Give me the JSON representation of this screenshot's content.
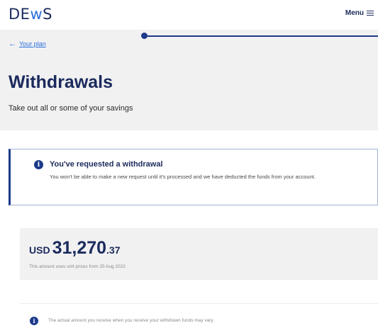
{
  "header": {
    "logo_prefix": "DE",
    "logo_accent": "w",
    "logo_suffix": "S",
    "menu_label": "Menu"
  },
  "nav": {
    "back_label": "Your plan"
  },
  "page": {
    "title": "Withdrawals",
    "subtitle": "Take out all or some of your savings"
  },
  "notice": {
    "icon": "info-icon",
    "title": "You've requested a withdrawal",
    "body": "You won't be able to make a new request until it's processed and we have deducted the funds from your account."
  },
  "balance": {
    "currency": "USD",
    "whole": "31,270",
    "cents": ".37",
    "note": "This amount uses unit prices from 25 Aug 2022"
  },
  "footer_note": {
    "icon": "info-icon",
    "text": "The actual amount you receive when you receive your withdrawn funds may vary."
  },
  "colors": {
    "brand": "#1b2a5c",
    "accent": "#2a6fdb",
    "panel": "#f1f1f2"
  }
}
